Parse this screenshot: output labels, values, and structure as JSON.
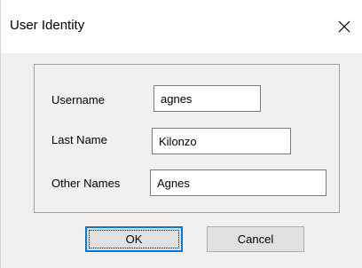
{
  "window": {
    "title": "User Identity",
    "close_icon": "close-icon"
  },
  "form": {
    "fields": [
      {
        "label": "Username",
        "value": "agnes"
      },
      {
        "label": "Last Name",
        "value": "Kilonzo"
      },
      {
        "label": "Other Names",
        "value": "Agnes"
      }
    ]
  },
  "buttons": {
    "ok_label": "OK",
    "cancel_label": "Cancel"
  },
  "colors": {
    "dialog_bg": "#f0f0f0",
    "titlebar_bg": "#ffffff",
    "button_bg": "#e1e1e1",
    "default_button_border": "#0078d7"
  }
}
